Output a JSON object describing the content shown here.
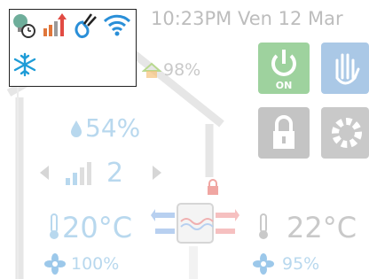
{
  "header": {
    "time": "10:23PM",
    "date": "Ven 12 Mar"
  },
  "status_icons": [
    "lightbulb-clock-icon",
    "signal-bars-up-icon",
    "hand-flame-icon",
    "wifi-icon",
    "snowflake-icon"
  ],
  "outside": {
    "humidity": "98%"
  },
  "room": {
    "humidity": "54%",
    "fan_level": "2",
    "indoor_temp": "20°C",
    "indoor_fan": "100%",
    "outdoor_temp": "22°C",
    "outdoor_fan": "95%"
  },
  "buttons": {
    "power_label": "ON"
  },
  "colors": {
    "power_green": "#9ed29e",
    "hand_blue": "#aac8e6",
    "lock_gray": "#c4c4c4",
    "text_blue": "#b8d8ee",
    "accent_red": "#e14b43"
  }
}
